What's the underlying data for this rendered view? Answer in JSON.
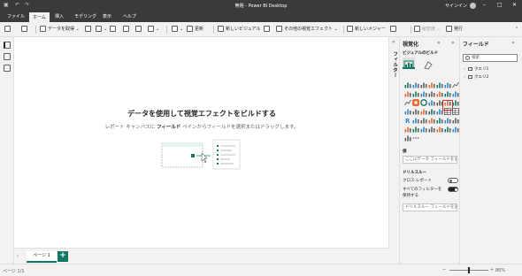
{
  "window": {
    "title": "無題 - Power BI Desktop",
    "signin": "サインイン"
  },
  "menu": {
    "tabs": [
      "ファイル",
      "ホーム",
      "挿入",
      "モデリング",
      "表示",
      "ヘルプ"
    ],
    "active": 1
  },
  "ribbon": {
    "get_data": "データを取得",
    "refresh": "更新",
    "new_visual": "新しいビジュアル",
    "more_visuals": "その他の視覚エフェクト",
    "new_measure": "新しいメジャー",
    "sensitivity": "秘密度",
    "publish": "発行"
  },
  "canvas": {
    "headline": "データを使用して視覚エフェクトをビルドする",
    "sub_before": "レポート キャンバスに ",
    "sub_bold": "フィールド",
    "sub_after": " ペインからフィールドを選択またはドラッグします。"
  },
  "pages": {
    "tab": "ページ 1",
    "add": "+"
  },
  "status": {
    "page": "ページ 1/1",
    "zoom": "86%",
    "zoom_level": 0.5
  },
  "filters": {
    "label": "フィルター"
  },
  "viz": {
    "title": "視覚化",
    "build": "ビジュアルのビルド",
    "values_head": "値",
    "values_placeholder": "ここにデータ フィールドを追加",
    "drill_head": "ドリルスルー",
    "cross_report": "クロス レポート",
    "cross_report_on": false,
    "keep_filters_1": "すべてのフィルターを",
    "keep_filters_2": "保持する",
    "keep_filters_on": true,
    "drill_placeholder": "ドリルスルー フィールドを追加"
  },
  "fields": {
    "title": "フィールド",
    "search_placeholder": "検索",
    "items": [
      "クエリ1",
      "クエリ2"
    ]
  },
  "colors": {
    "accent": "#117865",
    "titlebar": "#3b3a39",
    "selection": "#d13438"
  }
}
